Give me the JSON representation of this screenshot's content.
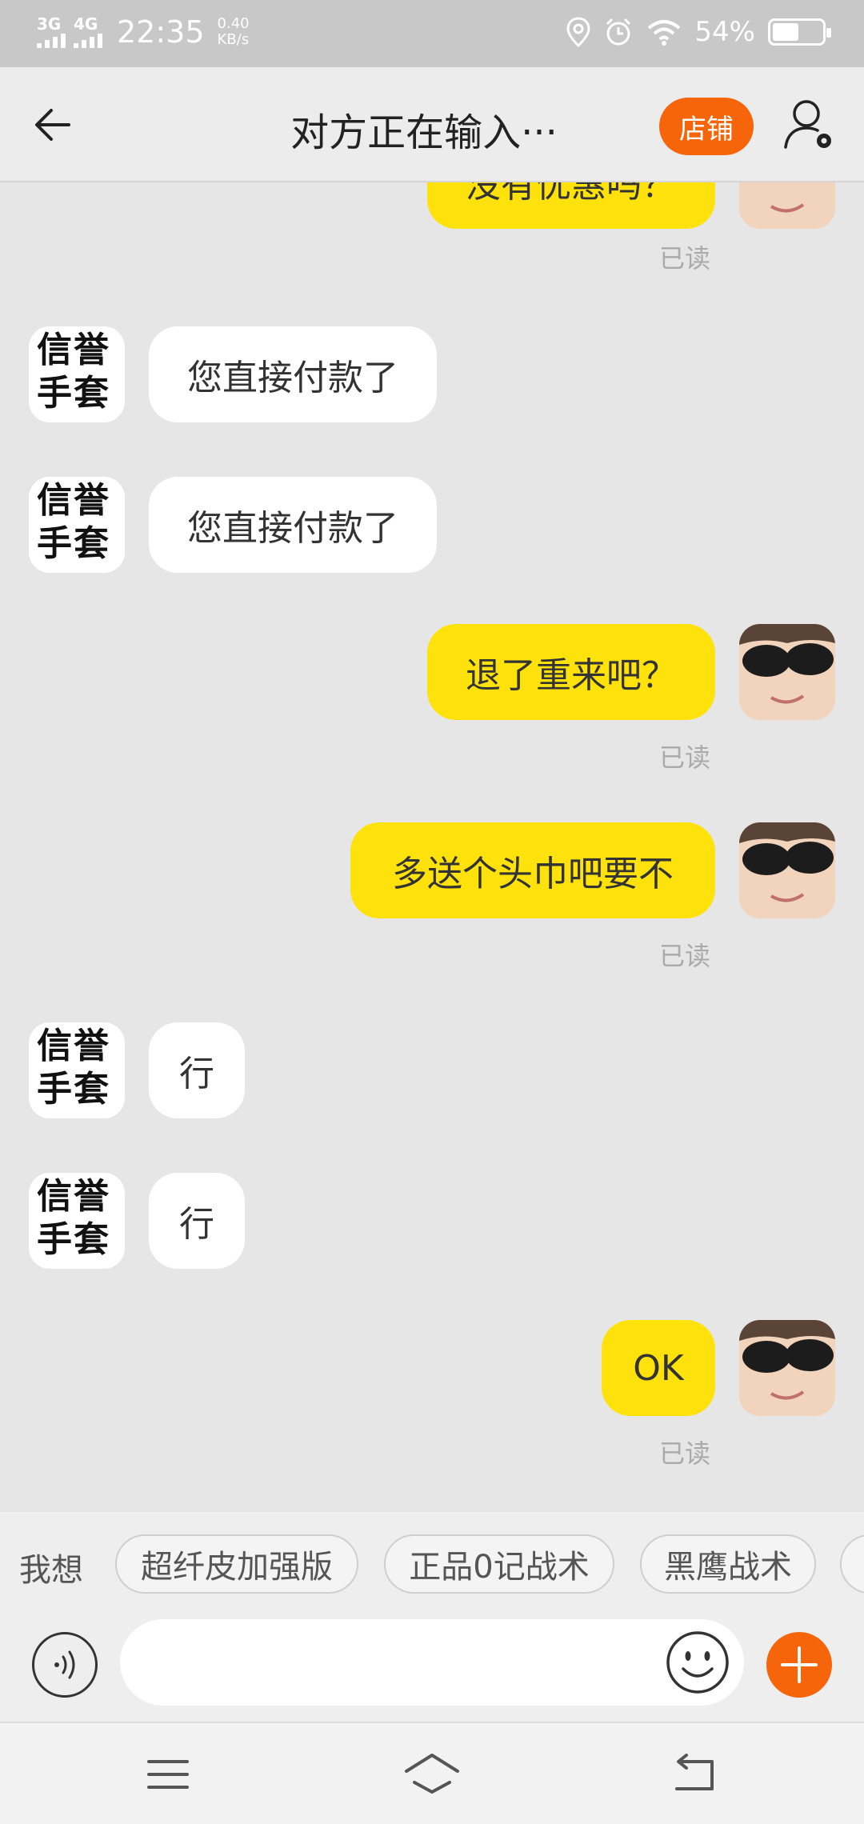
{
  "status_bar": {
    "net1": "3G",
    "net2": "4G",
    "time": "22:35",
    "speed_value": "0.40",
    "speed_unit": "KB/s",
    "battery_percent": "54%",
    "battery_level": 0.54
  },
  "header": {
    "title": "对方正在输入···",
    "shop_label": "店铺"
  },
  "shop": {
    "avatar_line1": "信誉",
    "avatar_line2": "手套"
  },
  "messages": {
    "partial_text": "没有优惠吗？",
    "read_label": "已读",
    "m1": "您直接付款了",
    "m2": "您直接付款了",
    "m3": "退了重来吧？",
    "m4": "多送个头巾吧要不",
    "m5": "行",
    "m6": "行",
    "m7": "OK"
  },
  "suggestions": {
    "label": "我想",
    "items": [
      "超纤皮加强版",
      "正品0记战术",
      "黑鹰战术"
    ]
  },
  "input": {
    "placeholder": ""
  },
  "colors": {
    "accent": "#f7650b",
    "outgoing_bubble": "#ffe20b",
    "incoming_bubble": "#ffffff",
    "chat_background": "#e6e6e6"
  }
}
